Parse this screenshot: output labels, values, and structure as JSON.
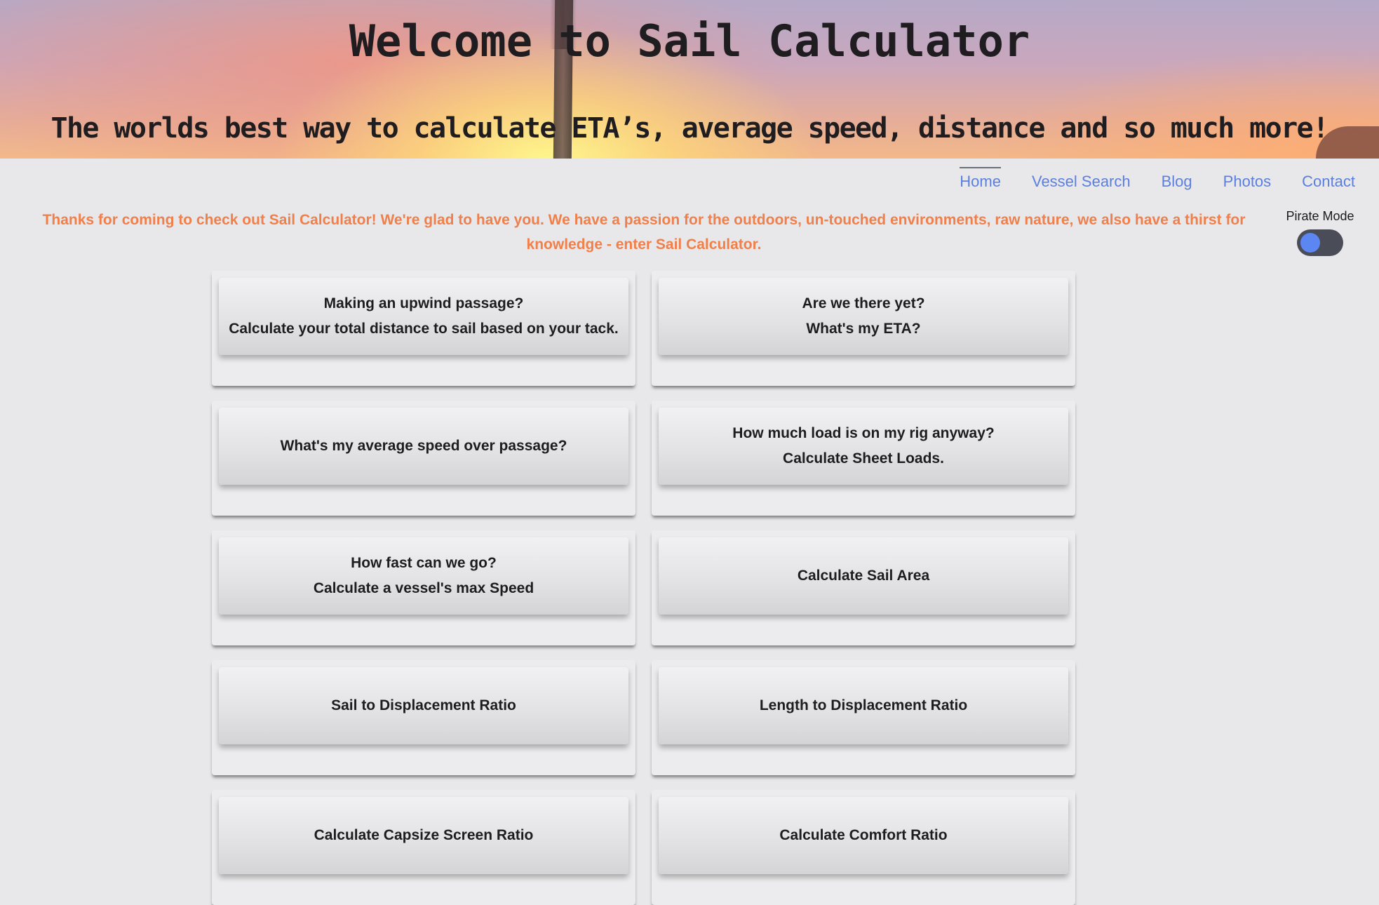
{
  "header": {
    "title": "Welcome to Sail Calculator",
    "subtitle": "The worlds best way to calculate ETA’s, average speed, distance and so much more!"
  },
  "nav": {
    "items": [
      {
        "label": "Home",
        "active": true
      },
      {
        "label": "Vessel Search",
        "active": false
      },
      {
        "label": "Blog",
        "active": false
      },
      {
        "label": "Photos",
        "active": false
      },
      {
        "label": "Contact",
        "active": false
      }
    ]
  },
  "intro": {
    "line1": "Thanks for coming to check out Sail Calculator! We're glad to have you. We have a passion for the outdoors, un-touched environments, raw nature, we also have a thirst for",
    "line2": "knowledge - enter Sail Calculator."
  },
  "pirate_mode": {
    "label": "Pirate Mode",
    "enabled": false
  },
  "calculators": [
    {
      "line1": "Making an upwind passage?",
      "line2": "Calculate your total distance to sail based on your tack."
    },
    {
      "line1": "Are we there yet?",
      "line2": "What's my ETA?"
    },
    {
      "line1": "What's my average speed over passage?",
      "line2": ""
    },
    {
      "line1": "How much load is on my rig anyway?",
      "line2": "Calculate Sheet Loads."
    },
    {
      "line1": "How fast can we go?",
      "line2": "Calculate a vessel's max Speed"
    },
    {
      "line1": "Calculate Sail Area",
      "line2": ""
    },
    {
      "line1": "Sail to Displacement Ratio",
      "line2": ""
    },
    {
      "line1": "Length to Displacement Ratio",
      "line2": ""
    },
    {
      "line1": "Calculate Capsize Screen Ratio",
      "line2": ""
    },
    {
      "line1": "Calculate Comfort Ratio",
      "line2": ""
    }
  ],
  "colors": {
    "accent_link": "#5b7fe0",
    "intro_text": "#f07f4a",
    "page_bg": "#e8e8ea",
    "toggle_knob": "#5c86f2"
  }
}
